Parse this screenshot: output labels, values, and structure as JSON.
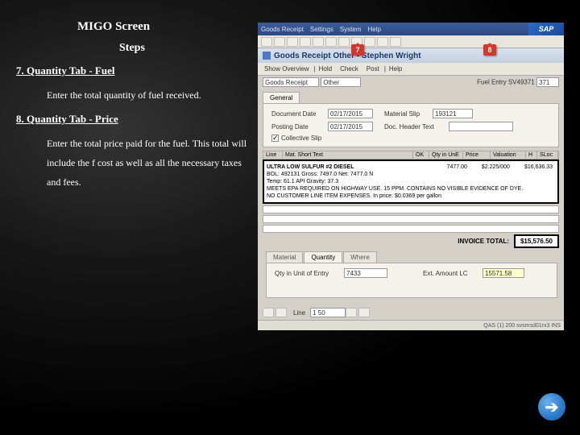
{
  "inst": {
    "title": "MIGO Screen",
    "subtitle": "Steps",
    "step7_h": "7.  Quantity Tab - Fuel",
    "step7_b": "Enter the total quantity of fuel received.",
    "step8_h": "8.  Quantity Tab - Price",
    "step8_b": "Enter the total price paid for the fuel.  This total will include the f cost as well as all the necessary taxes and fees."
  },
  "sap": {
    "menus": [
      "Goods Receipt",
      "Settings",
      "System",
      "Help"
    ],
    "title": "Goods Receipt Other - Stephen Wright",
    "toolbar2": {
      "overview": "Show Overview",
      "hold": "Hold",
      "check": "Check",
      "post": "Post",
      "help": "Help"
    },
    "action": {
      "label": "Goods Receipt",
      "val": "Other"
    },
    "fuel_entry": {
      "label": "Fuel Entry SV49371",
      "val": "371"
    },
    "gen_tab": "General",
    "doc_date": {
      "label": "Document Date",
      "val": "02/17/2015"
    },
    "posting": {
      "label": "Posting Date",
      "val": "02/17/2015"
    },
    "mat_slip": {
      "label": "Material Slip",
      "val": "193121"
    },
    "hdr_txt": {
      "label": "Doc. Header Text"
    },
    "coll_slip": "Collective Slip",
    "cols": {
      "line": "Line",
      "mat": "Mat. Short Text",
      "ok": "OK",
      "qty": "Qty in UnE",
      "price": "Price",
      "value": "Valuation",
      "h": "H",
      "sloc": "SLoc"
    },
    "detail": {
      "l1": "ULTRA LOW SULFUR #2 DIESEL",
      "l2": "BOL: 492131  Gross: 7497.0 Net: 7477.0 N",
      "l3": "Temp: 61.1   API Gravity: 37.3",
      "l4": "MEETS EPA REQUIRED ON HIGHWAY USE. 15 PPM. CONTAINS NO VISIBLE EVIDENCE OF DYE.",
      "l5": "NO CUSTOMER LINE ITEM EXPENSES. In price: $0.0369 per gallon",
      "qty": "7477.00",
      "unit": "$2.225/000",
      "amt": "$16,636.33"
    },
    "inv": {
      "label": "INVOICE TOTAL:",
      "amt": "$15,576.50"
    },
    "tabs2": {
      "material": "Material",
      "quantity": "Quantity",
      "where": "Where"
    },
    "qtyu": {
      "label": "Qty in Unit of Entry",
      "val": "7433"
    },
    "ext": {
      "label": "Ext. Amount LC",
      "val": "15571.58"
    },
    "line": {
      "label": "Line",
      "val": "1  50"
    },
    "status": "QAS (1)  200  svsmsd01rx3  INS"
  },
  "markers": {
    "a": "7",
    "b": "8"
  },
  "nav": "➔"
}
